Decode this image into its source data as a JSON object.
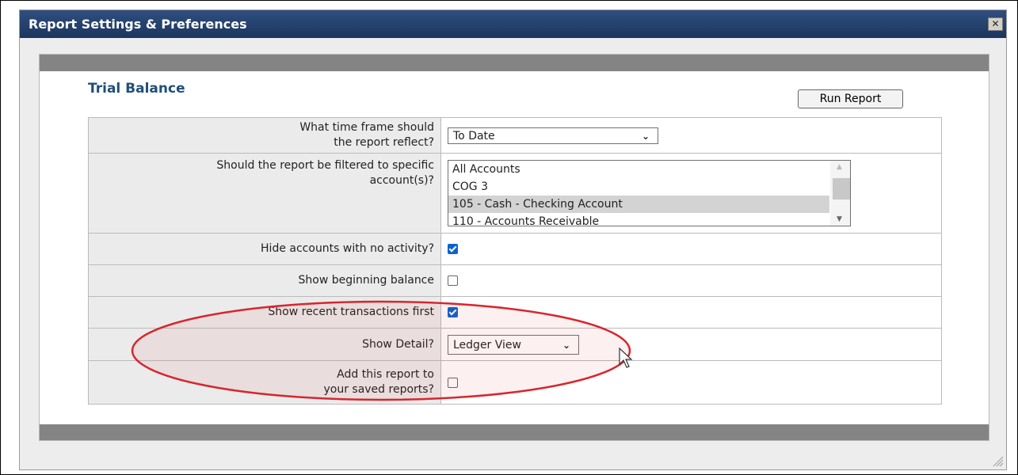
{
  "dialog": {
    "title": "Report Settings & Preferences",
    "close_label": "✕"
  },
  "report": {
    "title": "Trial Balance",
    "run_button": "Run Report"
  },
  "settings": {
    "time_frame": {
      "question_line1": "What time frame should",
      "question_line2": "the report reflect?",
      "value": "To Date"
    },
    "accounts": {
      "question_line1": "Should the report be filtered to specific",
      "question_line2": "account(s)?",
      "options": [
        {
          "label": "All Accounts",
          "selected": false
        },
        {
          "label": "COG 3",
          "selected": false
        },
        {
          "label": "105 - Cash - Checking Account",
          "selected": true
        },
        {
          "label": "110 - Accounts Receivable",
          "selected": false
        }
      ]
    },
    "hide_no_activity": {
      "question": "Hide accounts with no activity?",
      "checked": true
    },
    "beginning_balance": {
      "question": "Show beginning balance",
      "checked": false
    },
    "recent_first": {
      "question": "Show recent transactions first",
      "checked": true
    },
    "show_detail": {
      "question": "Show Detail?",
      "value": "Ledger View"
    },
    "save_report": {
      "question_line1": "Add this report to",
      "question_line2": "your saved reports?",
      "checked": false
    }
  },
  "colors": {
    "titlebar": "#1c355e",
    "annotation": "#d7262e",
    "checkbox": "#0b63cf"
  }
}
